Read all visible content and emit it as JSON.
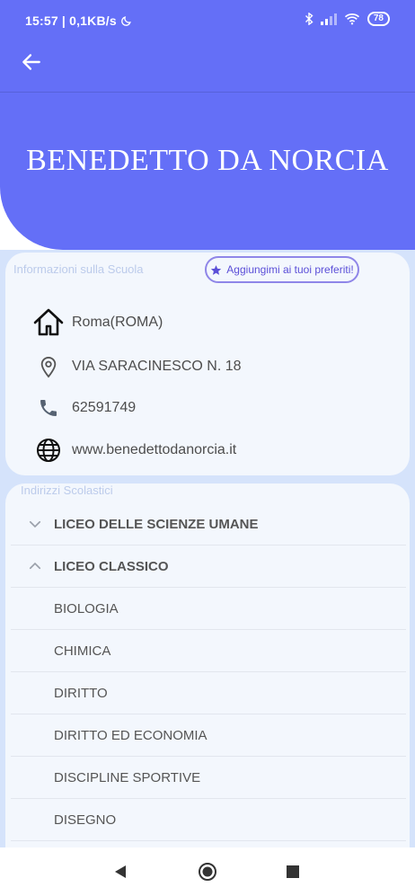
{
  "status_bar": {
    "time": "15:57 | 0,1KB/s",
    "battery": "78"
  },
  "school": {
    "name": "BENEDETTO DA NORCIA"
  },
  "info_card": {
    "title": "Informazioni sulla Scuola",
    "favorite_label": "Aggiungimi ai tuoi preferiti!",
    "city": "Roma(ROMA)",
    "address": "VIA SARACINESCO N. 18",
    "phone": "62591749",
    "website": "www.benedettodanorcia.it"
  },
  "addresses_card": {
    "title": "Indirizzi Scolastici",
    "groups": [
      {
        "label": "LICEO DELLE SCIENZE UMANE",
        "expanded": false
      },
      {
        "label": "LICEO CLASSICO",
        "expanded": true
      }
    ],
    "subjects": [
      "BIOLOGIA",
      "CHIMICA",
      "DIRITTO",
      "DIRITTO ED ECONOMIA",
      "DISCIPLINE SPORTIVE",
      "DISEGNO"
    ]
  },
  "colors": {
    "primary": "#646ff7",
    "background": "#d5e3fb",
    "card": "#f3f7fd",
    "accent": "#5b4fd8"
  },
  "icons": {
    "back": "arrow-left-icon",
    "favorite": "star-icon",
    "city": "home-icon",
    "address": "location-pin-icon",
    "phone": "phone-icon",
    "website": "globe-icon",
    "collapsed": "chevron-down-icon",
    "expanded": "chevron-up-icon"
  }
}
